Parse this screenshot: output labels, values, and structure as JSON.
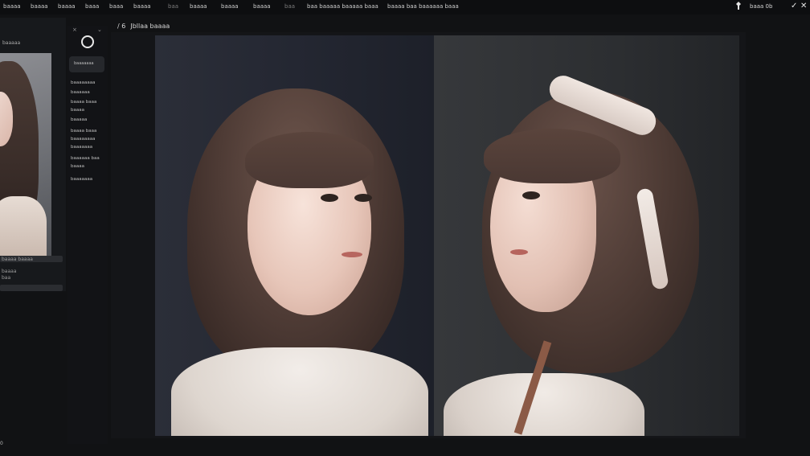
{
  "topbar": {
    "menu": [
      {
        "label": "baaaa",
        "dim": false
      },
      {
        "label": "baaaa",
        "dim": false
      },
      {
        "label": "baaaa",
        "dim": false
      },
      {
        "label": "baaa",
        "dim": false
      },
      {
        "label": "baaa",
        "dim": false
      },
      {
        "label": "baaaa",
        "dim": false
      },
      {
        "label": "baa",
        "dim": true
      },
      {
        "label": "baaaa",
        "dim": false
      },
      {
        "label": "baaaa",
        "dim": false
      },
      {
        "label": "baaaa",
        "dim": false
      },
      {
        "label": "baa",
        "dim": true
      },
      {
        "label": "baa baaaaa baaaaa baaa",
        "dim": false
      },
      {
        "label": "baaaa baa baaaaaa baaa",
        "dim": false
      }
    ],
    "status": "baaa 0b"
  },
  "icons": {
    "pin": "pin-icon",
    "check": "check-icon",
    "close": "close-icon",
    "settings_close": "close-icon",
    "settings_chevron": "chevron-down-icon",
    "ring": "circle-icon"
  },
  "left_panel": {
    "header": "baaaaa",
    "fields": [
      "baaaa baaaa",
      "baaaa",
      "baa"
    ]
  },
  "settings": {
    "pill_text": "baaaaaaa",
    "lines": [
      "baaaaaaaa",
      "baaaaaa",
      "baaaa baaa",
      "baaaa",
      "baaaaa",
      "baaaa baaa",
      "baaaaaaaa",
      "baaaaaaa",
      "baaaaaa baa",
      "baaaa",
      "baaaaaaa"
    ]
  },
  "canvas": {
    "title_prefix": "/ 6",
    "title": "Jbllaa baaaa"
  },
  "bottom": {
    "left_text": "0"
  }
}
